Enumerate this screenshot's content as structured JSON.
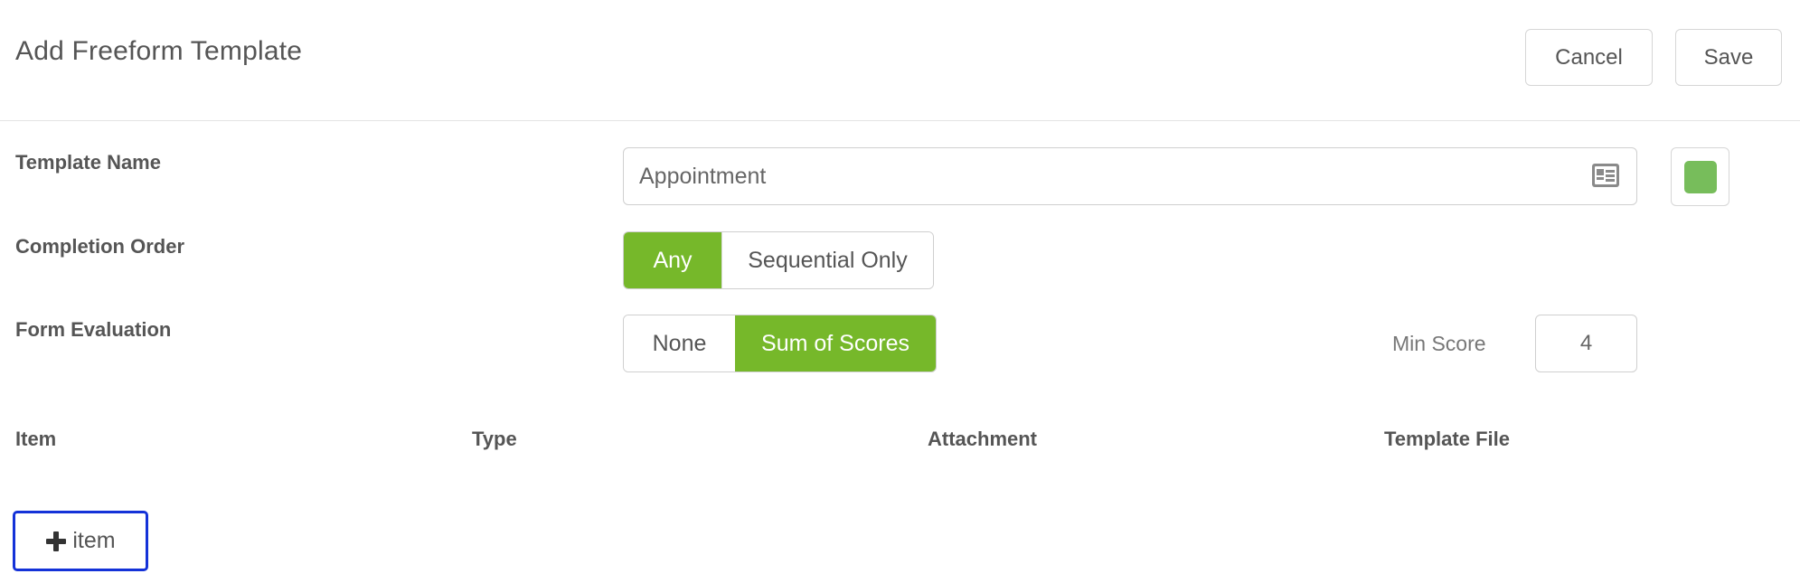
{
  "header": {
    "title": "Add Freeform Template",
    "cancel_label": "Cancel",
    "save_label": "Save"
  },
  "form": {
    "template_name": {
      "label": "Template Name",
      "value": "Appointment",
      "icon": "id-card-icon"
    },
    "color": "#77bd5b",
    "completion_order": {
      "label": "Completion Order",
      "options": [
        "Any",
        "Sequential Only"
      ],
      "selected": "Any"
    },
    "form_evaluation": {
      "label": "Form Evaluation",
      "options": [
        "None",
        "Sum of Scores"
      ],
      "selected": "Sum of Scores",
      "min_score_label": "Min Score",
      "min_score_value": "4"
    }
  },
  "table": {
    "columns": [
      "Item",
      "Type",
      "Attachment",
      "Template File"
    ]
  },
  "add_item": {
    "label": "item",
    "icon": "plus-icon"
  },
  "colors": {
    "accent_green": "#76b82a",
    "focus_blue": "#1432d8"
  }
}
